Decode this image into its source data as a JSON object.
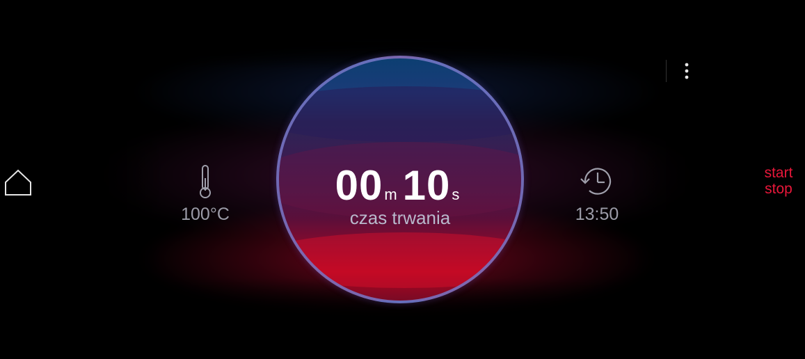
{
  "timer": {
    "minutes": "00",
    "minutes_unit": "m",
    "seconds": "10",
    "seconds_unit": "s",
    "caption": "czas trwania"
  },
  "temperature": {
    "value": "100°C",
    "icon": "thermometer-icon"
  },
  "end_time": {
    "value": "13:50",
    "icon": "clock-history-icon"
  },
  "controls": {
    "home_icon": "home-icon",
    "start_label": "start",
    "stop_label": "stop",
    "menu_icon": "more-vertical-icon"
  },
  "colors": {
    "accent": "#e8173a",
    "dial_top": "#0c3f72",
    "dial_bottom": "#b1061f",
    "text_secondary": "#9c9ca8"
  }
}
